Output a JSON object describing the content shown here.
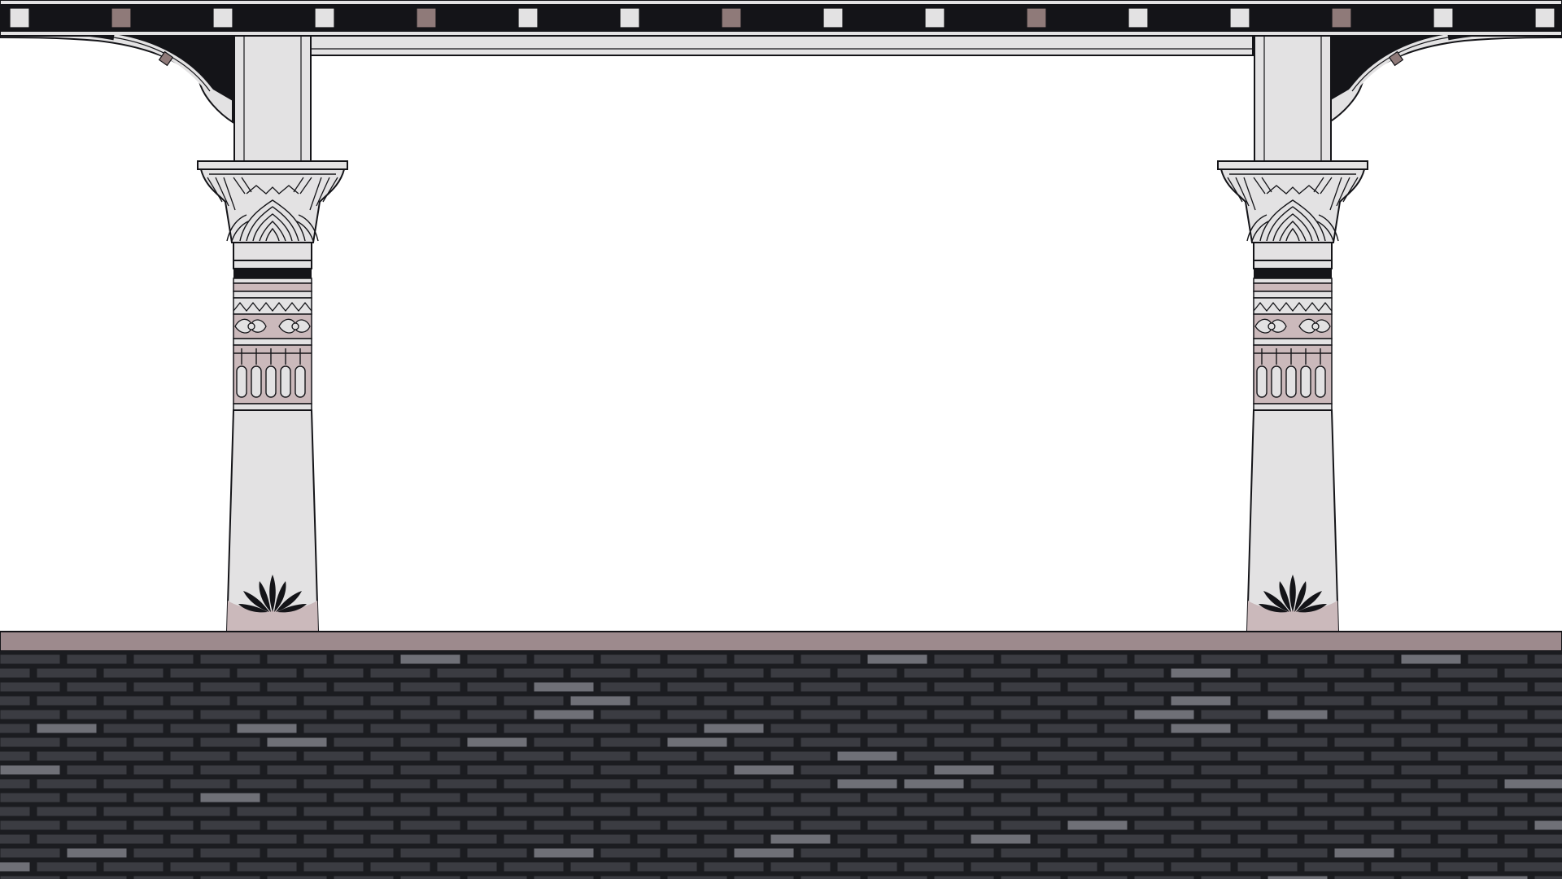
{
  "scene": {
    "type": "side-scrolling game background",
    "theme": "egyptian-temple-colonnade",
    "colors": {
      "background": "#ffffff",
      "stone_light": "#e3e2e3",
      "stone_mid": "#d2cfd2",
      "accent_mauve": "#8f7a79",
      "band_pink": "#cbb9bb",
      "ledge": "#9d8a8d",
      "outline": "#141418",
      "brick_dark": "#3b3c42",
      "brick_light": "#6f7077",
      "mortar": "#1b1c20"
    },
    "elements": {
      "frieze": "frieze-border-top",
      "columns": [
        "column-left",
        "column-right"
      ],
      "capital_motif": "papyrus-capital",
      "base_motif": "lotus-base",
      "floor": "brick-wall-floor"
    }
  }
}
